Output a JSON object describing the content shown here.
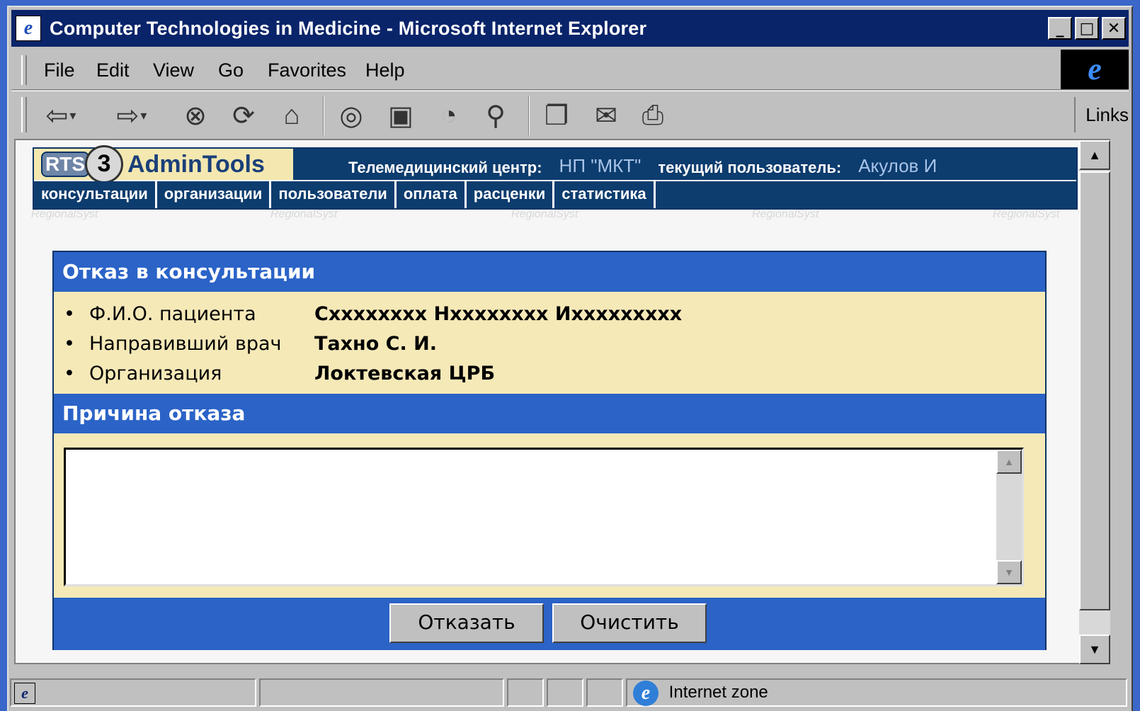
{
  "window": {
    "title": "Computer Technologies in Medicine - Microsoft Internet Explorer",
    "buttons": {
      "minimize": "_",
      "maximize": "□",
      "close": "✕"
    }
  },
  "menu": {
    "items": [
      {
        "label": "File"
      },
      {
        "label": "Edit"
      },
      {
        "label": "View"
      },
      {
        "label": "Go"
      },
      {
        "label": "Favorites"
      },
      {
        "label": "Help"
      }
    ]
  },
  "toolbar": {
    "links_label": "Links",
    "icons": [
      "back-icon",
      "forward-icon",
      "stop-icon",
      "refresh-icon",
      "home-icon",
      "search-icon",
      "favorites-icon",
      "history-icon",
      "channels-icon",
      "fullscreen-icon",
      "mail-icon",
      "print-icon"
    ]
  },
  "site": {
    "logo_rts": "RTS",
    "logo_number": "3",
    "logo_name": "AdminTools",
    "center_label": "Телемедицинский центр:",
    "center_value": "НП \"МКТ\"",
    "user_label": "текущий пользователь:",
    "user_value": "Акулов И",
    "nav": [
      "консультации",
      "организации",
      "пользователи",
      "оплата",
      "расценки",
      "статистика"
    ]
  },
  "panel": {
    "title": "Отказ в консультации",
    "fields": [
      {
        "label": "Ф.И.О. пациента",
        "value": "Схххххххх Нхххххххх Иххххххххх"
      },
      {
        "label": "Направивший врач",
        "value": "Тахно С. И."
      },
      {
        "label": "Организация",
        "value": "Локтевская ЦРБ"
      }
    ],
    "reason_title": "Причина отказа",
    "reason_value": "",
    "buttons": {
      "refuse": "Отказать",
      "clear": "Очистить"
    }
  },
  "status": {
    "zone": "Internet zone"
  },
  "colors": {
    "titlebar": "#0a246a",
    "site_blue": "#0d3c6e",
    "panel_blue": "#2b63c7",
    "panel_bg": "#f6e9b8"
  }
}
